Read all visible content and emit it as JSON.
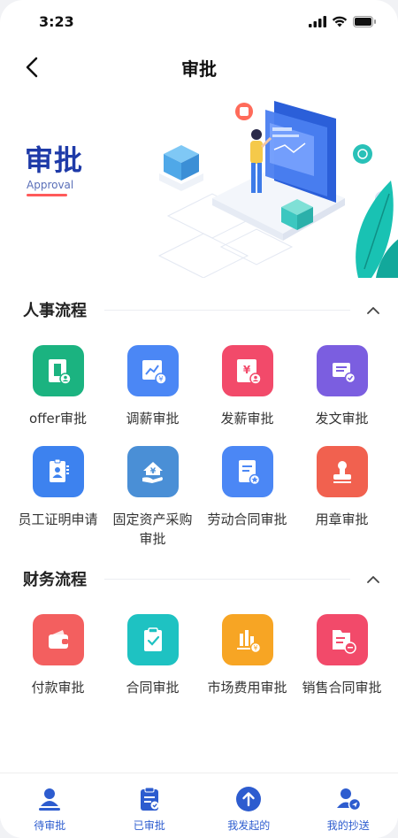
{
  "status": {
    "time": "3:23"
  },
  "nav": {
    "title": "审批"
  },
  "banner": {
    "title": "审批",
    "subtitle": "Approval"
  },
  "sections": [
    {
      "title": "人事流程",
      "items": [
        {
          "label": "offer审批",
          "color": "#1bb380",
          "icon": "offer-icon"
        },
        {
          "label": "调薪审批",
          "color": "#4b87f5",
          "icon": "salary-adjust-icon"
        },
        {
          "label": "发薪审批",
          "color": "#f24a6a",
          "icon": "payroll-icon"
        },
        {
          "label": "发文审批",
          "color": "#7b5ee0",
          "icon": "document-issue-icon"
        },
        {
          "label": "员工证明申请",
          "color": "#3d82ef",
          "icon": "employee-certificate-icon"
        },
        {
          "label": "固定资产采购审批",
          "color": "#4a8fd6",
          "icon": "asset-purchase-icon"
        },
        {
          "label": "劳动合同审批",
          "color": "#4b87f5",
          "icon": "labor-contract-icon"
        },
        {
          "label": "用章审批",
          "color": "#f1614f",
          "icon": "seal-icon"
        }
      ]
    },
    {
      "title": "财务流程",
      "items": [
        {
          "label": "付款审批",
          "color": "#f35f5f",
          "icon": "wallet-icon"
        },
        {
          "label": "合同审批",
          "color": "#1ec2c2",
          "icon": "clipboard-check-icon"
        },
        {
          "label": "市场费用审批",
          "color": "#f7a524",
          "icon": "market-expense-icon"
        },
        {
          "label": "销售合同审批",
          "color": "#f24a6a",
          "icon": "sales-contract-icon"
        }
      ]
    }
  ],
  "tabs": [
    {
      "label": "待审批",
      "icon": "pending-icon"
    },
    {
      "label": "已审批",
      "icon": "approved-icon"
    },
    {
      "label": "我发起的",
      "icon": "initiated-icon"
    },
    {
      "label": "我的抄送",
      "icon": "cc-icon"
    }
  ]
}
